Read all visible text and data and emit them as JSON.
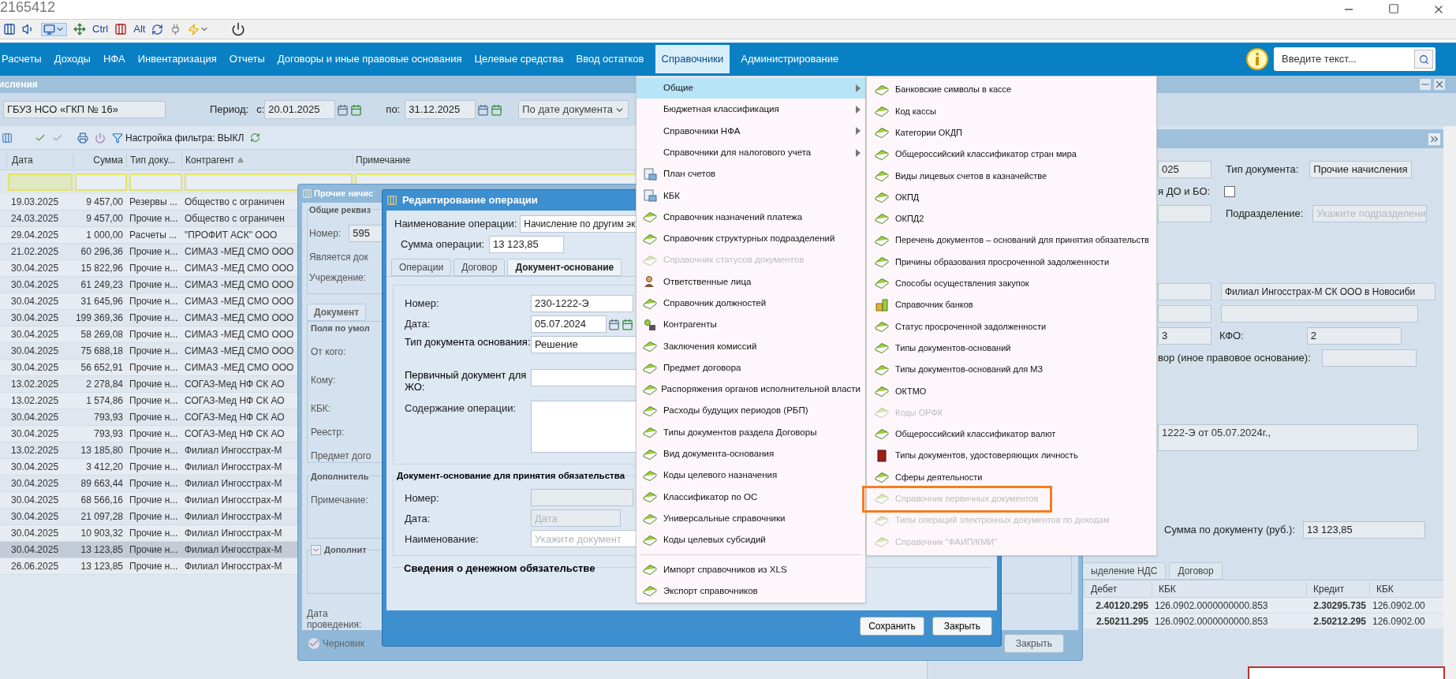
{
  "window": {
    "title": "2165412"
  },
  "toolbar": {
    "ctrl_label": "Ctrl",
    "alt_label": "Alt"
  },
  "nav": {
    "items": [
      {
        "label": "Расчеты",
        "selected": false
      },
      {
        "label": "Доходы",
        "selected": false
      },
      {
        "label": "НФА",
        "selected": false
      },
      {
        "label": "Инвентаризация",
        "selected": false
      },
      {
        "label": "Отчеты",
        "selected": false
      },
      {
        "label": "Договоры и иные правовые основания",
        "selected": false
      },
      {
        "label": "Целевые средства",
        "selected": false
      },
      {
        "label": "Ввод остатков",
        "selected": false
      },
      {
        "label": "Справочники",
        "selected": true
      },
      {
        "label": "Администрирование",
        "selected": false
      }
    ],
    "search": {
      "placeholder": "Введите текст..."
    }
  },
  "main_window": {
    "title": "исления",
    "institution": "ГБУЗ НСО «ГКП № 16»",
    "period_label": "Период:",
    "from_label": "с:",
    "from": "20.01.2025",
    "to_label": "по:",
    "to": "31.12.2025",
    "date_mode": "По дате документа",
    "filter_toggle": "Настройка фильтра: ВЫКЛ"
  },
  "table": {
    "columns": [
      "Дата",
      "Сумма",
      "Тип доку...",
      "Контрагент",
      "Примечание"
    ],
    "rows": [
      {
        "date": "19.03.2025",
        "sum": "9 457,00",
        "type": "Резервы ...",
        "counterparty": "Общество с ограничен",
        "selected": false
      },
      {
        "date": "24.03.2025",
        "sum": "9 457,00",
        "type": "Прочие н...",
        "counterparty": "Общество с ограничен",
        "selected": false
      },
      {
        "date": "29.04.2025",
        "sum": "1 000,00",
        "type": "Расчеты ...",
        "counterparty": "\"ПРОФИТ АСК\" ООО",
        "selected": false
      },
      {
        "date": "21.02.2025",
        "sum": "60 296,36",
        "type": "Прочие н...",
        "counterparty": "СИМАЗ -МЕД СМО ООО",
        "selected": false
      },
      {
        "date": "30.04.2025",
        "sum": "15 822,96",
        "type": "Прочие н...",
        "counterparty": "СИМАЗ -МЕД СМО ООО",
        "selected": false
      },
      {
        "date": "30.04.2025",
        "sum": "61 249,23",
        "type": "Прочие н...",
        "counterparty": "СИМАЗ -МЕД СМО ООО",
        "selected": false
      },
      {
        "date": "30.04.2025",
        "sum": "31 645,96",
        "type": "Прочие н...",
        "counterparty": "СИМАЗ -МЕД СМО ООО",
        "selected": false
      },
      {
        "date": "30.04.2025",
        "sum": "199 369,36",
        "type": "Прочие н...",
        "counterparty": "СИМАЗ -МЕД СМО ООО",
        "selected": false
      },
      {
        "date": "30.04.2025",
        "sum": "58 269,08",
        "type": "Прочие н...",
        "counterparty": "СИМАЗ -МЕД СМО ООО",
        "selected": false
      },
      {
        "date": "30.04.2025",
        "sum": "75 688,18",
        "type": "Прочие н...",
        "counterparty": "СИМАЗ -МЕД СМО ООО",
        "selected": false
      },
      {
        "date": "30.04.2025",
        "sum": "56 652,91",
        "type": "Прочие н...",
        "counterparty": "СИМАЗ -МЕД СМО ООО",
        "selected": false
      },
      {
        "date": "13.02.2025",
        "sum": "2 278,84",
        "type": "Прочие н...",
        "counterparty": "СОГАЗ-Мед НФ СК АО",
        "selected": false
      },
      {
        "date": "13.02.2025",
        "sum": "1 574,86",
        "type": "Прочие н...",
        "counterparty": "СОГАЗ-Мед НФ СК АО",
        "selected": false
      },
      {
        "date": "30.04.2025",
        "sum": "793,93",
        "type": "Прочие н...",
        "counterparty": "СОГАЗ-Мед НФ СК АО",
        "selected": false
      },
      {
        "date": "30.04.2025",
        "sum": "793,93",
        "type": "Прочие н...",
        "counterparty": "СОГАЗ-Мед НФ СК АО",
        "selected": false
      },
      {
        "date": "13.02.2025",
        "sum": "13 185,80",
        "type": "Прочие н...",
        "counterparty": "Филиал Ингосстрах-М",
        "selected": false
      },
      {
        "date": "30.04.2025",
        "sum": "3 412,20",
        "type": "Прочие н...",
        "counterparty": "Филиал Ингосстрах-М",
        "selected": false
      },
      {
        "date": "30.04.2025",
        "sum": "89 663,44",
        "type": "Прочие н...",
        "counterparty": "Филиал Ингосстрах-М",
        "selected": false
      },
      {
        "date": "30.04.2025",
        "sum": "68 566,16",
        "type": "Прочие н...",
        "counterparty": "Филиал Ингосстрах-М",
        "selected": false
      },
      {
        "date": "30.04.2025",
        "sum": "21 097,28",
        "type": "Прочие н...",
        "counterparty": "Филиал Ингосстрах-М",
        "selected": false
      },
      {
        "date": "30.04.2025",
        "sum": "10 903,32",
        "type": "Прочие н...",
        "counterparty": "Филиал Ингосстрах-М",
        "selected": false
      },
      {
        "date": "30.04.2025",
        "sum": "13 123,85",
        "type": "Прочие н...",
        "counterparty": "Филиал Ингосстрах-М",
        "selected": true
      },
      {
        "date": "26.06.2025",
        "sum": "13 123,85",
        "type": "Прочие н...",
        "counterparty": "Филиал Ингосстрах-М",
        "selected": false
      }
    ]
  },
  "details": {
    "number_tail": "025",
    "doc_type_label": "Тип документа:",
    "doc_type": "Прочие начисления",
    "flag_label": "я ДО и БО:",
    "flag_checked": false,
    "division_label": "Подразделение:",
    "division_placeholder": "Укажите подразделени",
    "counterparty": "Филиал Ингосстрах-М СК ООО в Новосиби",
    "code_tail": "3",
    "kfo_label": "КФО:",
    "kfo": "2",
    "contract_label": "вор (иное правовое основание):",
    "basis_text": "1222-Э от 05.07.2024г.,",
    "sum_label": "Сумма по документу (руб.):",
    "sum": "13 123,85",
    "tabs": [
      {
        "label": "ыделение НДС",
        "selected": false
      },
      {
        "label": "Договор",
        "selected": false
      }
    ],
    "entries": {
      "columns": [
        "Дебет",
        "КБК",
        "Кредит",
        "КБК"
      ],
      "rows": [
        [
          "2.40120.295",
          "126.0902.0000000000.853",
          "2.30295.735",
          "126.0902.00"
        ],
        [
          "2.50211.295",
          "126.0902.0000000000.853",
          "2.50212.295",
          "126.0902.00"
        ]
      ]
    }
  },
  "dialog_accrual": {
    "title": "Прочие начис",
    "group_general": "Общие реквиз",
    "number_label": "Номер:",
    "number": "595",
    "is_doc_label": "Является док",
    "institution_label": "Учреждение:",
    "tab": "Документ",
    "group_defaults": "Поля по умол",
    "from_label": "От кого:",
    "to_label": "Кому:",
    "kbk_label": "КБК:",
    "registry_label": "Реестр:",
    "subject_label": "Предмет дого",
    "group_extra": "Дополнитель",
    "note_label": "Примечание:",
    "collapsible": {
      "label": "Дополнит",
      "expanded": false
    },
    "posting_date_label": "Дата проведения:",
    "status": "Черновик",
    "close_button": "Закрыть"
  },
  "dialog_operation": {
    "title": "Редактирование операции",
    "name_label": "Наименование операции:",
    "name_value": "Начисление по другим эк",
    "sum_label": "Сумма операции:",
    "sum_value": "13 123,85",
    "tabs": [
      {
        "label": "Операции",
        "selected": false
      },
      {
        "label": "Договор",
        "selected": false
      },
      {
        "label": "Документ-основание",
        "selected": true
      }
    ],
    "number_label": "Номер:",
    "number": "230-1222-Э",
    "date_label": "Дата:",
    "date": "05.07.2024",
    "basis_type_label": "Тип документа основания:",
    "basis_type": "Решение",
    "primary_label": "Первичный документ для ЖО:",
    "content_label": "Содержание операции:",
    "obligation_title": "Документ-основание для принятия обязательства",
    "obligation_number_label": "Номер:",
    "obligation_date_label": "Дата:",
    "obligation_date_placeholder": "Дата",
    "obligation_name_label": "Наименование:",
    "obligation_name_placeholder": "Укажите документ",
    "money_title": "Сведения о денежном обязательстве",
    "save_button": "Сохранить",
    "close_button": "Закрыть"
  },
  "menu": {
    "items": [
      {
        "label": "Общие",
        "kind": "submenu",
        "disabled": false,
        "selected": true
      },
      {
        "label": "Бюджетная классификация",
        "kind": "submenu",
        "disabled": false,
        "selected": false
      },
      {
        "label": "Справочники НФА",
        "kind": "submenu",
        "disabled": false,
        "selected": false
      },
      {
        "label": "Справочники для налогового учета",
        "kind": "submenu",
        "disabled": false,
        "selected": false
      },
      {
        "label": "План счетов",
        "kind": "ledger",
        "disabled": false,
        "selected": false
      },
      {
        "label": "КБК",
        "kind": "ledger",
        "disabled": false,
        "selected": false
      },
      {
        "label": "Справочник назначений платежа",
        "kind": "book",
        "disabled": false,
        "selected": false
      },
      {
        "label": "Справочник структурных подразделений",
        "kind": "book",
        "disabled": false,
        "selected": false
      },
      {
        "label": "Справочник статусов документов",
        "kind": "book",
        "disabled": true,
        "selected": false
      },
      {
        "label": "Ответственные лица",
        "kind": "person",
        "disabled": false,
        "selected": false
      },
      {
        "label": "Справочник должностей",
        "kind": "book",
        "disabled": false,
        "selected": false
      },
      {
        "label": "Контрагенты",
        "kind": "seal",
        "disabled": false,
        "selected": false
      },
      {
        "label": "Заключения комиссий",
        "kind": "book",
        "disabled": false,
        "selected": false
      },
      {
        "label": "Предмет договора",
        "kind": "book",
        "disabled": false,
        "selected": false
      },
      {
        "label": "Распоряжения органов исполнительной власти",
        "kind": "book",
        "disabled": false,
        "selected": false
      },
      {
        "label": "Расходы будущих периодов (РБП)",
        "kind": "book",
        "disabled": false,
        "selected": false
      },
      {
        "label": "Типы документов раздела Договоры",
        "kind": "book",
        "disabled": false,
        "selected": false
      },
      {
        "label": "Вид документа-основания",
        "kind": "book",
        "disabled": false,
        "selected": false
      },
      {
        "label": "Коды целевого назначения",
        "kind": "book",
        "disabled": false,
        "selected": false
      },
      {
        "label": "Классификатор по ОС",
        "kind": "book",
        "disabled": false,
        "selected": false
      },
      {
        "label": "Универсальные справочники",
        "kind": "book",
        "disabled": false,
        "selected": false
      },
      {
        "label": "Коды целевых субсидий",
        "kind": "book",
        "disabled": false,
        "selected": false
      }
    ],
    "bottom_items": [
      {
        "label": "Импорт справочников из XLS",
        "kind": "book",
        "disabled": false,
        "selected": false
      },
      {
        "label": "Экспорт справочников",
        "kind": "book",
        "disabled": false,
        "selected": false
      }
    ]
  },
  "submenu": {
    "items": [
      {
        "label": "Банковские символы в кассе",
        "kind": "book",
        "disabled": false,
        "highlighted": false
      },
      {
        "label": "Код кассы",
        "kind": "book",
        "disabled": false,
        "highlighted": false
      },
      {
        "label": "Категории ОКДП",
        "kind": "book",
        "disabled": false,
        "highlighted": false
      },
      {
        "label": "Общероссийский классификатор стран мира",
        "kind": "book",
        "disabled": false,
        "highlighted": false
      },
      {
        "label": "Виды лицевых счетов в казначействе",
        "kind": "book",
        "disabled": false,
        "highlighted": false
      },
      {
        "label": "ОКПД",
        "kind": "book",
        "disabled": false,
        "highlighted": false
      },
      {
        "label": "ОКПД2",
        "kind": "book",
        "disabled": false,
        "highlighted": false
      },
      {
        "label": "Перечень документов – оснований для принятия обязательств",
        "kind": "book",
        "disabled": false,
        "highlighted": false
      },
      {
        "label": "Причины образования просроченной задолженности",
        "kind": "book",
        "disabled": false,
        "highlighted": false
      },
      {
        "label": "Способы осуществления закупок",
        "kind": "book",
        "disabled": false,
        "highlighted": false
      },
      {
        "label": "Справочник банков",
        "kind": "bank",
        "disabled": false,
        "highlighted": false
      },
      {
        "label": "Статус просроченной задолженности",
        "kind": "book",
        "disabled": false,
        "highlighted": false
      },
      {
        "label": "Типы документов-оснований",
        "kind": "book",
        "disabled": false,
        "highlighted": false
      },
      {
        "label": "Типы документов-оснований для МЗ",
        "kind": "book",
        "disabled": false,
        "highlighted": false
      },
      {
        "label": "ОКТМО",
        "kind": "book",
        "disabled": false,
        "highlighted": false
      },
      {
        "label": "Коды ОРФК",
        "kind": "book",
        "disabled": true,
        "highlighted": false
      },
      {
        "label": "Общероссийский классификатор валют",
        "kind": "book",
        "disabled": false,
        "highlighted": false
      },
      {
        "label": "Типы документов, удостоверяющих личность",
        "kind": "passport",
        "disabled": false,
        "highlighted": false
      },
      {
        "label": "Сферы деятельности",
        "kind": "book",
        "disabled": false,
        "highlighted": false
      },
      {
        "label": "Справочник первичных документов",
        "kind": "book",
        "disabled": true,
        "highlighted": true
      },
      {
        "label": "Типы операций электронных документов по доходам",
        "kind": "book",
        "disabled": true,
        "highlighted": false
      },
      {
        "label": "Справочник \"ФАИП/КМИ\"",
        "kind": "book",
        "disabled": true,
        "highlighted": false
      }
    ]
  }
}
